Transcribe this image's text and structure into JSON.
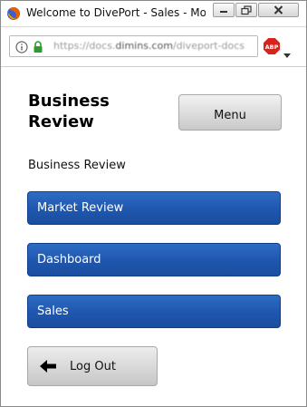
{
  "window": {
    "title": "Welcome to DivePort - Sales - Mozi",
    "url_prefix": "https://docs.",
    "url_host": "dimins.com",
    "url_suffix": "/diveport-docs",
    "addon_label": "ABP"
  },
  "page": {
    "title": "Business Review",
    "menu_label": "Menu",
    "breadcrumb": "Business Review"
  },
  "nav": {
    "items": [
      {
        "label": "Market Review"
      },
      {
        "label": "Dashboard"
      },
      {
        "label": "Sales"
      }
    ]
  },
  "logout": {
    "label": "Log Out"
  },
  "colors": {
    "nav_blue": "#1f56ad",
    "button_gray": "#d4d4d4"
  }
}
